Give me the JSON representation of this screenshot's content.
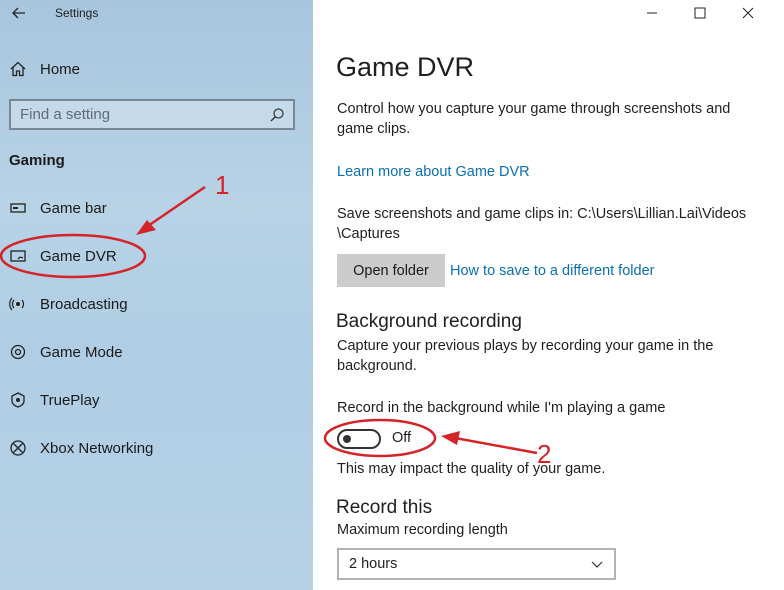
{
  "window": {
    "title": "Settings"
  },
  "sidebar": {
    "home_label": "Home",
    "search_placeholder": "Find a setting",
    "section": "Gaming",
    "items": [
      {
        "label": "Game bar",
        "icon": "game-bar-icon"
      },
      {
        "label": "Game DVR",
        "icon": "game-dvr-icon",
        "selected": true
      },
      {
        "label": "Broadcasting",
        "icon": "broadcasting-icon"
      },
      {
        "label": "Game Mode",
        "icon": "game-mode-icon"
      },
      {
        "label": "TruePlay",
        "icon": "trueplay-icon"
      },
      {
        "label": "Xbox Networking",
        "icon": "xbox-icon"
      }
    ]
  },
  "main": {
    "title": "Game DVR",
    "description": "Control how you capture your game through screenshots and game clips.",
    "learn_more": "Learn more about Game DVR",
    "save_location_text": "Save screenshots and game clips in: C:\\Users\\Lillian.Lai\\Videos \\Captures",
    "open_folder_label": "Open folder",
    "how_to_save_link": "How to save to a different folder",
    "bg_recording": {
      "heading": "Background recording",
      "description": "Capture your previous plays by recording your game in the background.",
      "toggle_label": "Record in the background while I'm playing a game",
      "toggle_state": "Off",
      "toggle_on": false,
      "note": "This may impact the quality of your game."
    },
    "record_this": {
      "heading": "Record this",
      "max_length_label": "Maximum recording length",
      "max_length_value": "2 hours"
    }
  },
  "annotations": {
    "label1": "1",
    "label2": "2",
    "color": "#d4242a"
  },
  "colors": {
    "sidebar_bg": "#afcde4",
    "link": "#0a6fb3",
    "button_bg": "#cccccc"
  }
}
